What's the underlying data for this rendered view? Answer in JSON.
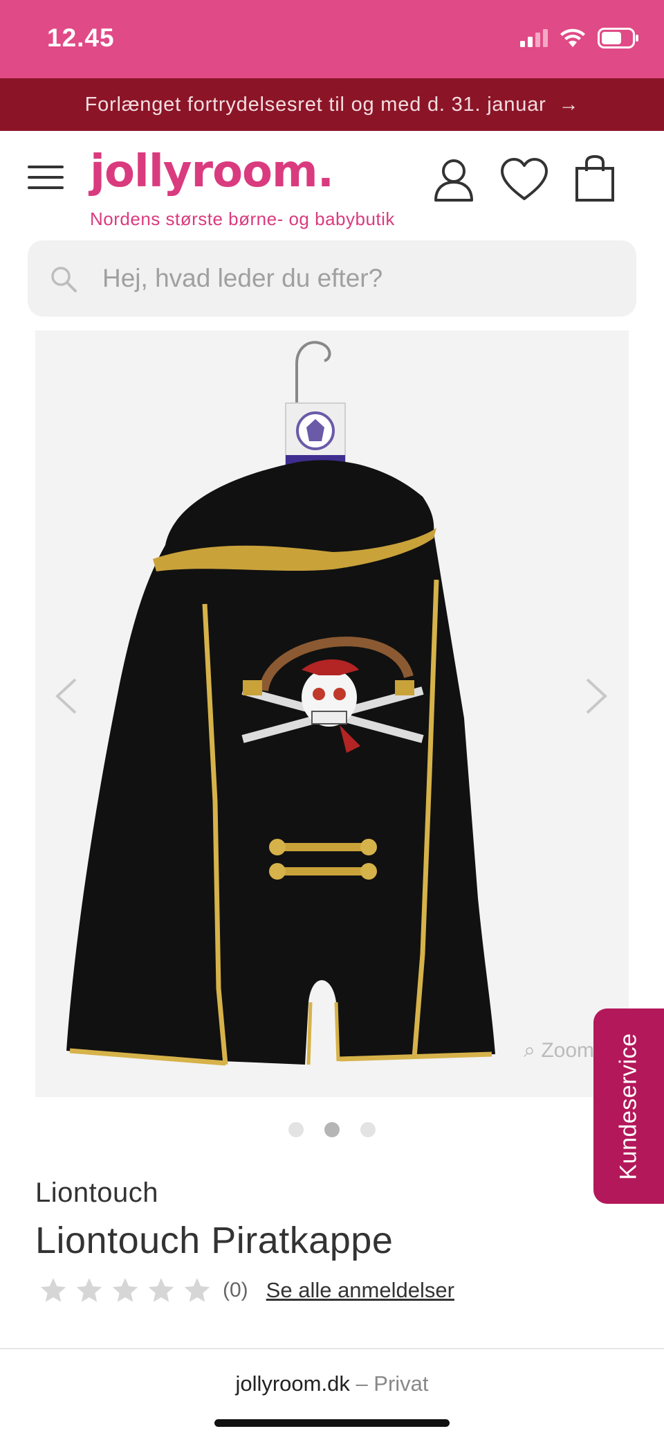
{
  "status_bar": {
    "time": "12.45",
    "signal_icon": "signal-icon",
    "wifi_icon": "wifi-icon",
    "battery_icon": "battery-icon"
  },
  "promo_banner": {
    "text": "Forlænget fortrydelsesret til og med d. 31. januar",
    "arrow": "→"
  },
  "header": {
    "logo": "jollyroom.",
    "tagline": "Nordens største børne- og babybutik",
    "icons": [
      "menu-icon",
      "account-icon",
      "heart-icon",
      "bag-icon"
    ]
  },
  "search": {
    "placeholder": "Hej, hvad leder du efter?"
  },
  "gallery": {
    "image": "pirate-cape-image",
    "zoom_label": "Zoom",
    "prev_icon": "chevron-left-icon",
    "next_icon": "chevron-right-icon",
    "dots": 3,
    "active_dot": 2
  },
  "product": {
    "brand": "Liontouch",
    "title": "Liontouch Piratkappe",
    "rating_stars": 0,
    "rating_max": 5,
    "rating_count": "(0)",
    "reviews_link": "Se alle anmeldelser"
  },
  "kundeservice": {
    "label": "Kundeservice"
  },
  "browser": {
    "domain": "jollyroom.dk",
    "separator": " – ",
    "mode": "Privat"
  },
  "colors": {
    "brand_pink": "#d93b7e",
    "status_pink": "#e04a86",
    "banner_red": "#8b1527",
    "kundeservice": "#b3185a"
  }
}
